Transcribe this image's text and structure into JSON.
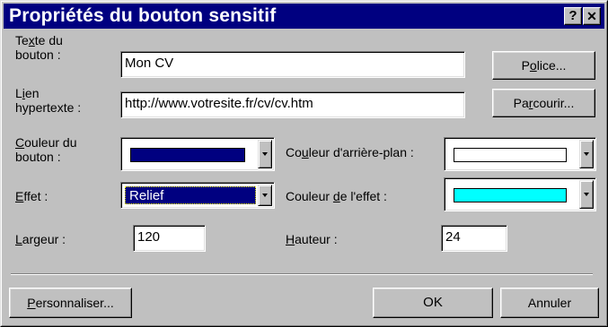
{
  "window": {
    "title": "Propriétés du bouton sensitif",
    "help_glyph": "?",
    "close_glyph": "✕"
  },
  "labels": {
    "button_text": [
      "Te",
      "x",
      "te du",
      "bouton :"
    ],
    "link": [
      "L",
      "i",
      "en",
      "hypertexte :"
    ],
    "button_color": [
      "",
      "C",
      "ouleur du",
      "bouton :"
    ],
    "bg_color": [
      "Co",
      "u",
      "leur d'arrière-plan :"
    ],
    "effect": [
      "",
      "E",
      "ffet :"
    ],
    "effect_color": [
      "Couleur ",
      "d",
      "e l'effet :"
    ],
    "width": [
      "",
      "L",
      "argeur :"
    ],
    "height": [
      "",
      "H",
      "auteur :"
    ]
  },
  "fields": {
    "button_text": "Mon CV",
    "link": "http://www.votresite.fr/cv/cv.htm",
    "effect": "Relief",
    "width": "120",
    "height": "24"
  },
  "buttons": {
    "police": [
      "P",
      "o",
      "lice..."
    ],
    "parcourir": [
      "Pa",
      "r",
      "courir..."
    ],
    "personnaliser": [
      "",
      "P",
      "ersonnaliser..."
    ],
    "ok": "OK",
    "annuler": "Annuler"
  },
  "colors": {
    "button_color": "#000080",
    "bg_color": "#ffffff",
    "effect_color": "#00ffff",
    "selection": "#000080"
  }
}
